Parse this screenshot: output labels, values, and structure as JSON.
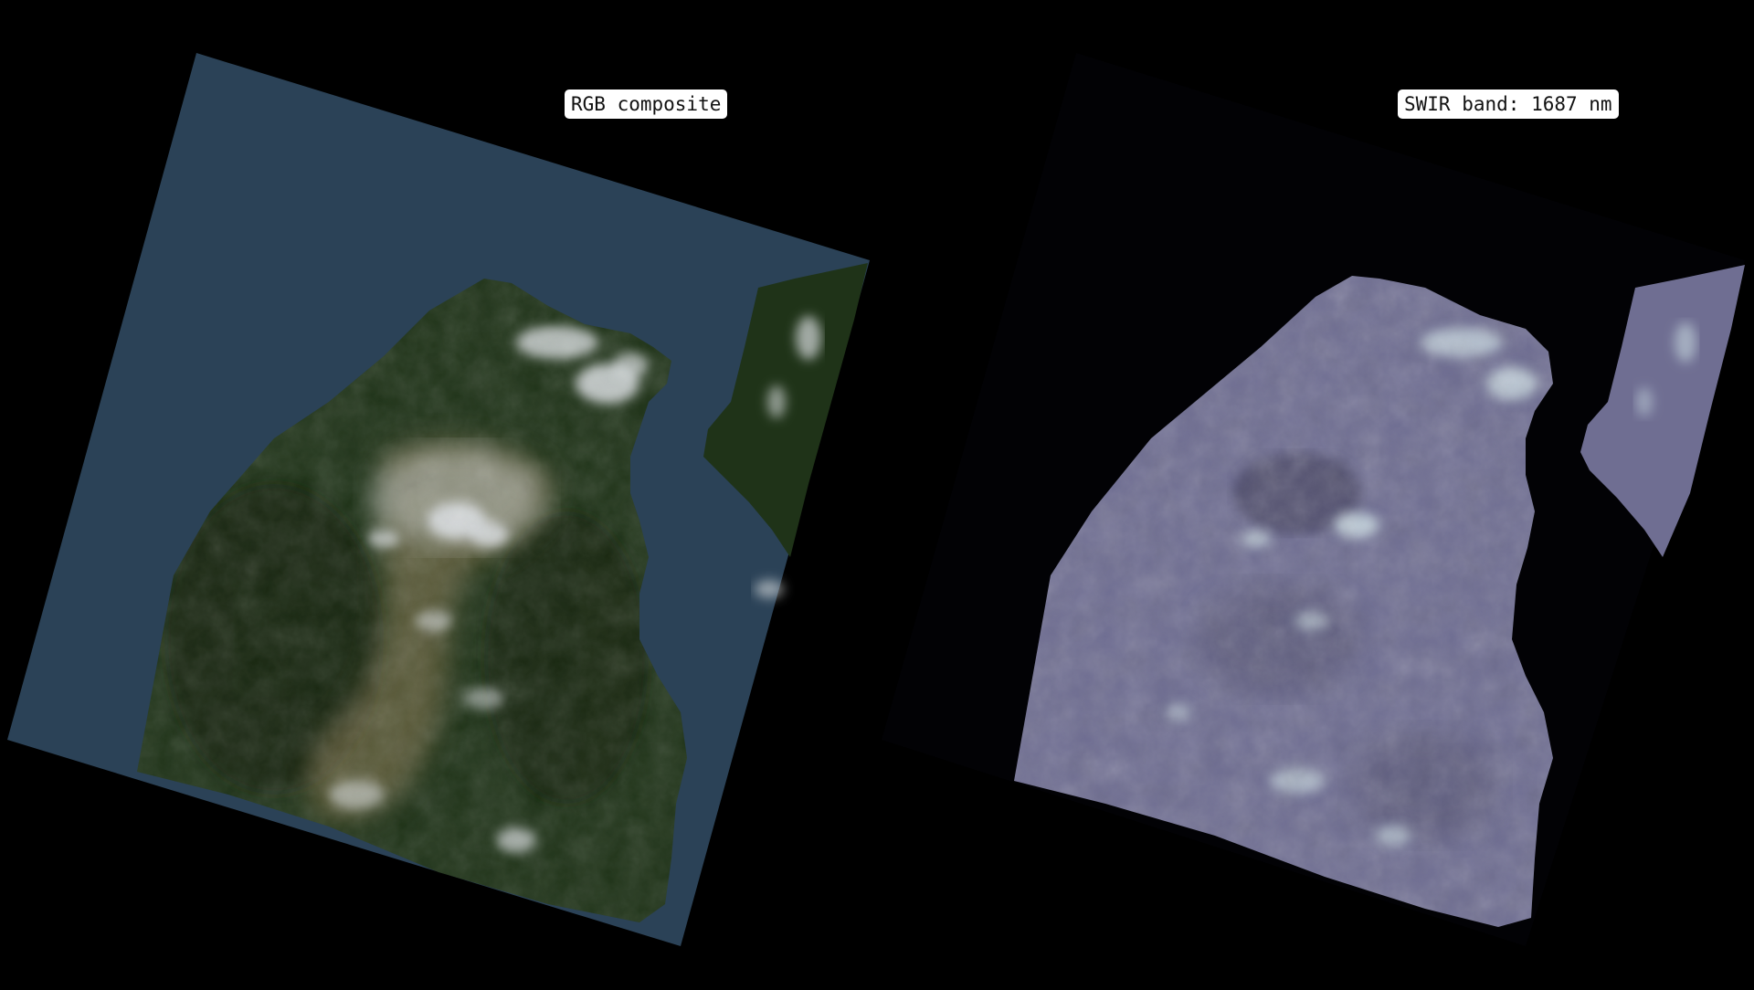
{
  "panels": [
    {
      "id": "rgb",
      "label": "RGB composite",
      "image_type": "rgb-satellite-composite",
      "colors": {
        "sea": "#2b4257",
        "land": "#1f3318",
        "land_dark": "#142410",
        "cloud": "#d9dde0",
        "bare": "#8a7a55"
      }
    },
    {
      "id": "swir",
      "label": "SWIR band: 1687 nm",
      "image_type": "single-band-swir-grayscale",
      "colors": {
        "sea": "#020205",
        "land": "#6f6e92",
        "land_dark": "#4b4a66",
        "cloud": "#c8d8e0"
      }
    }
  ],
  "background": "#000000"
}
